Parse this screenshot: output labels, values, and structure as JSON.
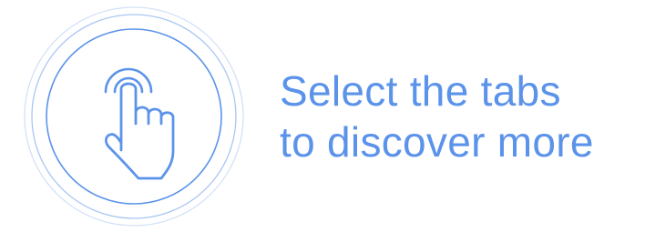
{
  "hint": {
    "icon": "tap-hand-icon",
    "accent_color": "#5b93ea",
    "ring_color_outer": "#d2e1f8",
    "ring_color_middle": "#a9c6f3",
    "line1": "Select the tabs",
    "line2": "to discover more"
  }
}
